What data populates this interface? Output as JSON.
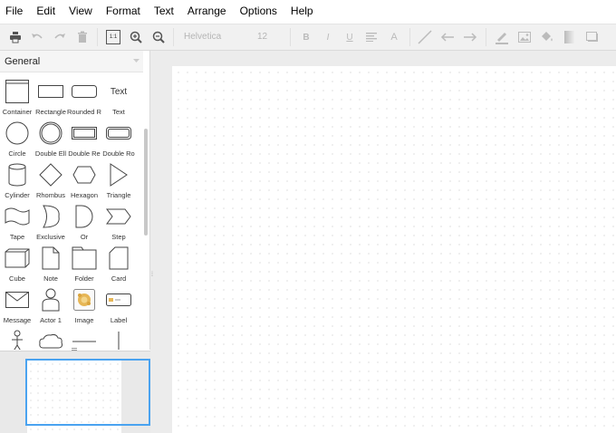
{
  "menubar": {
    "items": [
      "File",
      "Edit",
      "View",
      "Format",
      "Text",
      "Arrange",
      "Options",
      "Help"
    ]
  },
  "toolbar": {
    "font_name": "Helvetica",
    "font_size": "12",
    "zoom_reset_label": "1:1",
    "format_bold": "B",
    "format_italic": "I",
    "format_underline": "U",
    "format_font_color": "A"
  },
  "sidebar": {
    "title": "General",
    "shapes": [
      {
        "label": "Container",
        "icon": "container-icon"
      },
      {
        "label": "Rectangle",
        "icon": "rectangle-icon"
      },
      {
        "label": "Rounded R",
        "icon": "rounded-rectangle-icon"
      },
      {
        "label": "Text",
        "icon": "text-shape-icon",
        "glyph_text": "Text"
      },
      {
        "label": "Circle",
        "icon": "circle-icon"
      },
      {
        "label": "Double Ell",
        "icon": "double-ellipse-icon"
      },
      {
        "label": "Double Re",
        "icon": "double-rectangle-icon"
      },
      {
        "label": "Double Ro",
        "icon": "double-rounded-icon"
      },
      {
        "label": "Cylinder",
        "icon": "cylinder-icon"
      },
      {
        "label": "Rhombus",
        "icon": "rhombus-icon"
      },
      {
        "label": "Hexagon",
        "icon": "hexagon-icon"
      },
      {
        "label": "Triangle",
        "icon": "triangle-icon"
      },
      {
        "label": "Tape",
        "icon": "tape-icon"
      },
      {
        "label": "Exclusive",
        "icon": "exclusive-icon"
      },
      {
        "label": "Or",
        "icon": "or-icon"
      },
      {
        "label": "Step",
        "icon": "step-icon"
      },
      {
        "label": "Cube",
        "icon": "cube-icon"
      },
      {
        "label": "Note",
        "icon": "note-icon"
      },
      {
        "label": "Folder",
        "icon": "folder-icon"
      },
      {
        "label": "Card",
        "icon": "card-icon"
      },
      {
        "label": "Message",
        "icon": "message-icon"
      },
      {
        "label": "Actor 1",
        "icon": "actor-icon"
      },
      {
        "label": "Image",
        "icon": "image-icon"
      },
      {
        "label": "Label",
        "icon": "label-icon"
      }
    ]
  },
  "colors": {
    "accent": "#4aa3f0",
    "toolbar_bg": "#f1f1f1",
    "canvas_bg": "#ececec"
  }
}
